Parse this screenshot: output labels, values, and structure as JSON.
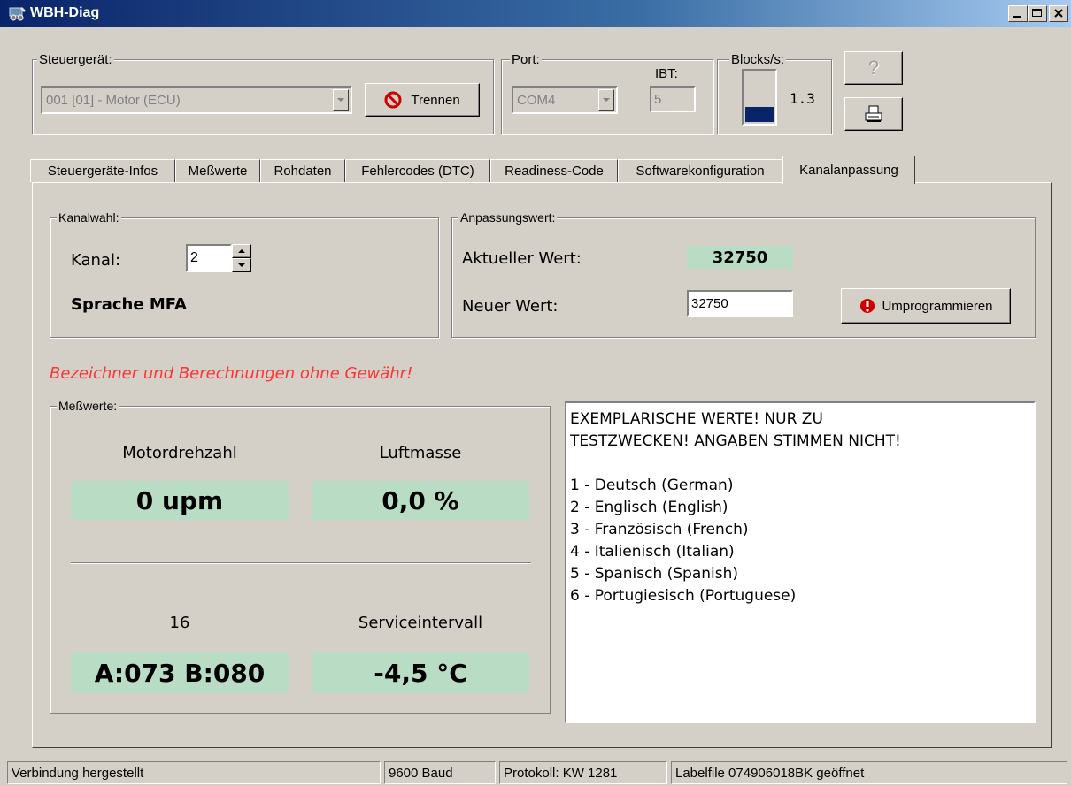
{
  "window": {
    "title": "WBH-Diag"
  },
  "controller": {
    "label": "Steuergerät:",
    "selected": "001 [01] - Motor (ECU)",
    "disconnect_label": "Trennen"
  },
  "port": {
    "label": "Port:",
    "selected": "COM4",
    "ibt_label": "IBT:",
    "ibt_value": "5"
  },
  "blocks": {
    "label": "Blocks/s:",
    "value": "1.3",
    "level": 0.3
  },
  "tabs": [
    "Steuergeräte-Infos",
    "Meßwerte",
    "Rohdaten",
    "Fehlercodes (DTC)",
    "Readiness-Code",
    "Softwarekonfiguration",
    "Kanalanpassung"
  ],
  "active_tab": "Kanalanpassung",
  "channel": {
    "group_label": "Kanalwahl:",
    "label": "Kanal:",
    "value": "2",
    "name": "Sprache MFA"
  },
  "adaptation": {
    "group_label": "Anpassungswert:",
    "current_label": "Aktueller Wert:",
    "current_value": "32750",
    "new_label": "Neuer Wert:",
    "new_value": "32750",
    "reprogram_label": "Umprogrammieren"
  },
  "disclaimer": "Bezeichner und Berechnungen ohne Gewähr!",
  "measurements": {
    "group_label": "Meßwerte:",
    "items": [
      {
        "label": "Motordrehzahl",
        "value": "0 upm"
      },
      {
        "label": "Luftmasse",
        "value": "0,0 %"
      },
      {
        "label": "16",
        "value": "A:073 B:080"
      },
      {
        "label": "Serviceintervall",
        "value": "-4,5 °C"
      }
    ]
  },
  "info_text": {
    "header": [
      "EXEMPLARISCHE WERTE! NUR ZU",
      "TESTZWECKEN! ANGABEN STIMMEN NICHT!"
    ],
    "options": [
      "1 - Deutsch (German)",
      "2 - Englisch (English)",
      "3 - Französisch (French)",
      "4 - Italienisch (Italian)",
      "5 - Spanisch (Spanish)",
      "6 - Portugiesisch (Portuguese)"
    ]
  },
  "status_bar": [
    "Verbindung hergestellt",
    "9600 Baud",
    "Protokoll: KW 1281",
    "Labelfile 074906018BK geöffnet"
  ],
  "colors": {
    "title_start": "#0a246a",
    "title_end": "#a6caf0",
    "value_bg": "#b9dcc4",
    "disclaimer": "#ff3333",
    "bar": "#0a246a",
    "face": "#d4d0c8"
  }
}
